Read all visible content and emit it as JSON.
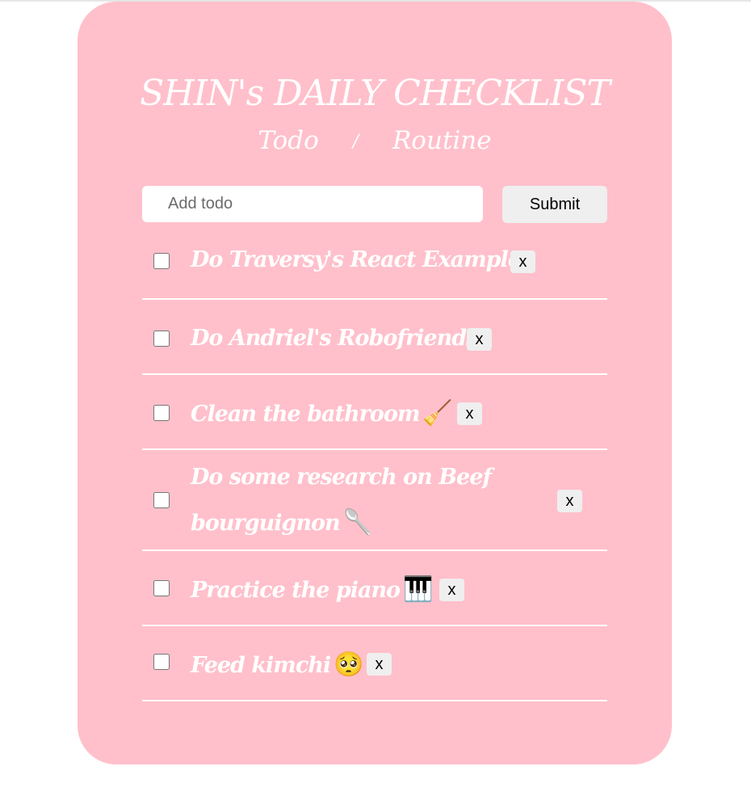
{
  "header": {
    "title": "SHIN's DAILY CHECKLIST",
    "nav": {
      "todo_label": "Todo",
      "separator": "/",
      "routine_label": "Routine"
    }
  },
  "form": {
    "placeholder": "Add todo",
    "value": "",
    "submit_label": "Submit"
  },
  "todos": [
    {
      "text": "Do Traversy's React Example",
      "emoji": "",
      "checked": false,
      "delete_label": "x"
    },
    {
      "text": "Do Andriel's Robofriends",
      "emoji": "",
      "checked": false,
      "delete_label": "x"
    },
    {
      "text": "Clean the bathroom",
      "emoji": "🧹",
      "checked": false,
      "delete_label": "x"
    },
    {
      "text": "Do some research on Beef bourguignon",
      "emoji": "🥄",
      "checked": false,
      "delete_label": "x"
    },
    {
      "text": "Practice the piano",
      "emoji": "🎹",
      "checked": false,
      "delete_label": "x"
    },
    {
      "text": "Feed kimchi",
      "emoji": "🥺",
      "checked": false,
      "delete_label": "x"
    }
  ],
  "colors": {
    "card_background": "#ffc0cb",
    "text": "#ffffff",
    "button_background": "#efefef"
  }
}
